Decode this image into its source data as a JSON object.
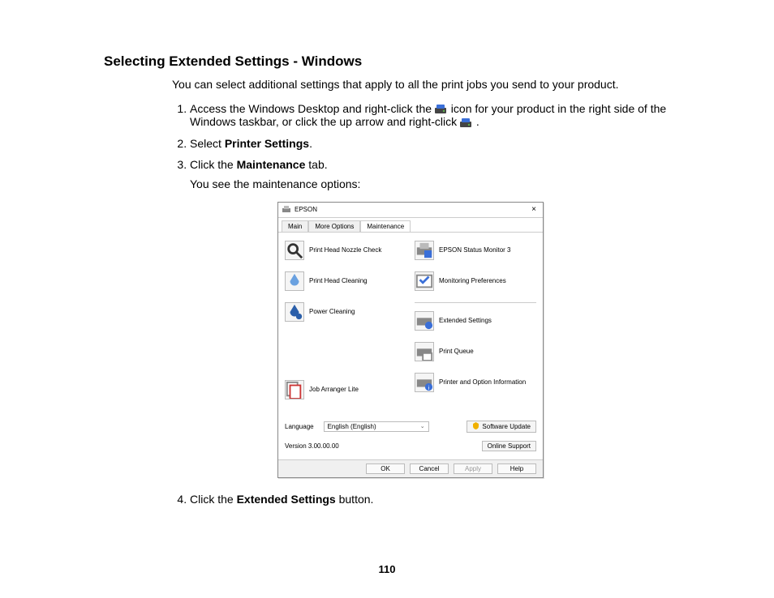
{
  "title": "Selecting Extended Settings - Windows",
  "intro": "You can select additional settings that apply to all the print jobs you send to your product.",
  "steps": {
    "s1_a": "Access the Windows Desktop and right-click the ",
    "s1_b": " icon for your product in the right side of the Windows taskbar, or click the up arrow and right-click ",
    "s1_c": ".",
    "s2_a": "Select ",
    "s2_b_bold": "Printer Settings",
    "s2_c": ".",
    "s3_a": "Click the ",
    "s3_b_bold": "Maintenance",
    "s3_c": " tab.",
    "s3_sub": "You see the maintenance options:",
    "s4_a": "Click the ",
    "s4_b_bold": "Extended Settings",
    "s4_c": " button."
  },
  "dialog": {
    "title": "EPSON",
    "tabs": {
      "main": "Main",
      "more": "More Options",
      "maint": "Maintenance"
    },
    "left": {
      "nozzle": "Print Head Nozzle Check",
      "clean": "Print Head Cleaning",
      "power": "Power Cleaning",
      "arranger": "Job Arranger Lite"
    },
    "right": {
      "status": "EPSON Status Monitor 3",
      "monpref": "Monitoring Preferences",
      "extset": "Extended Settings",
      "queue": "Print Queue",
      "printinfo": "Printer and Option Information"
    },
    "lang_label": "Language",
    "lang_value": "English (English)",
    "software_update": "Software Update",
    "version": "Version 3.00.00.00",
    "online_support": "Online Support",
    "buttons": {
      "ok": "OK",
      "cancel": "Cancel",
      "apply": "Apply",
      "help": "Help"
    }
  },
  "page_number": "110"
}
